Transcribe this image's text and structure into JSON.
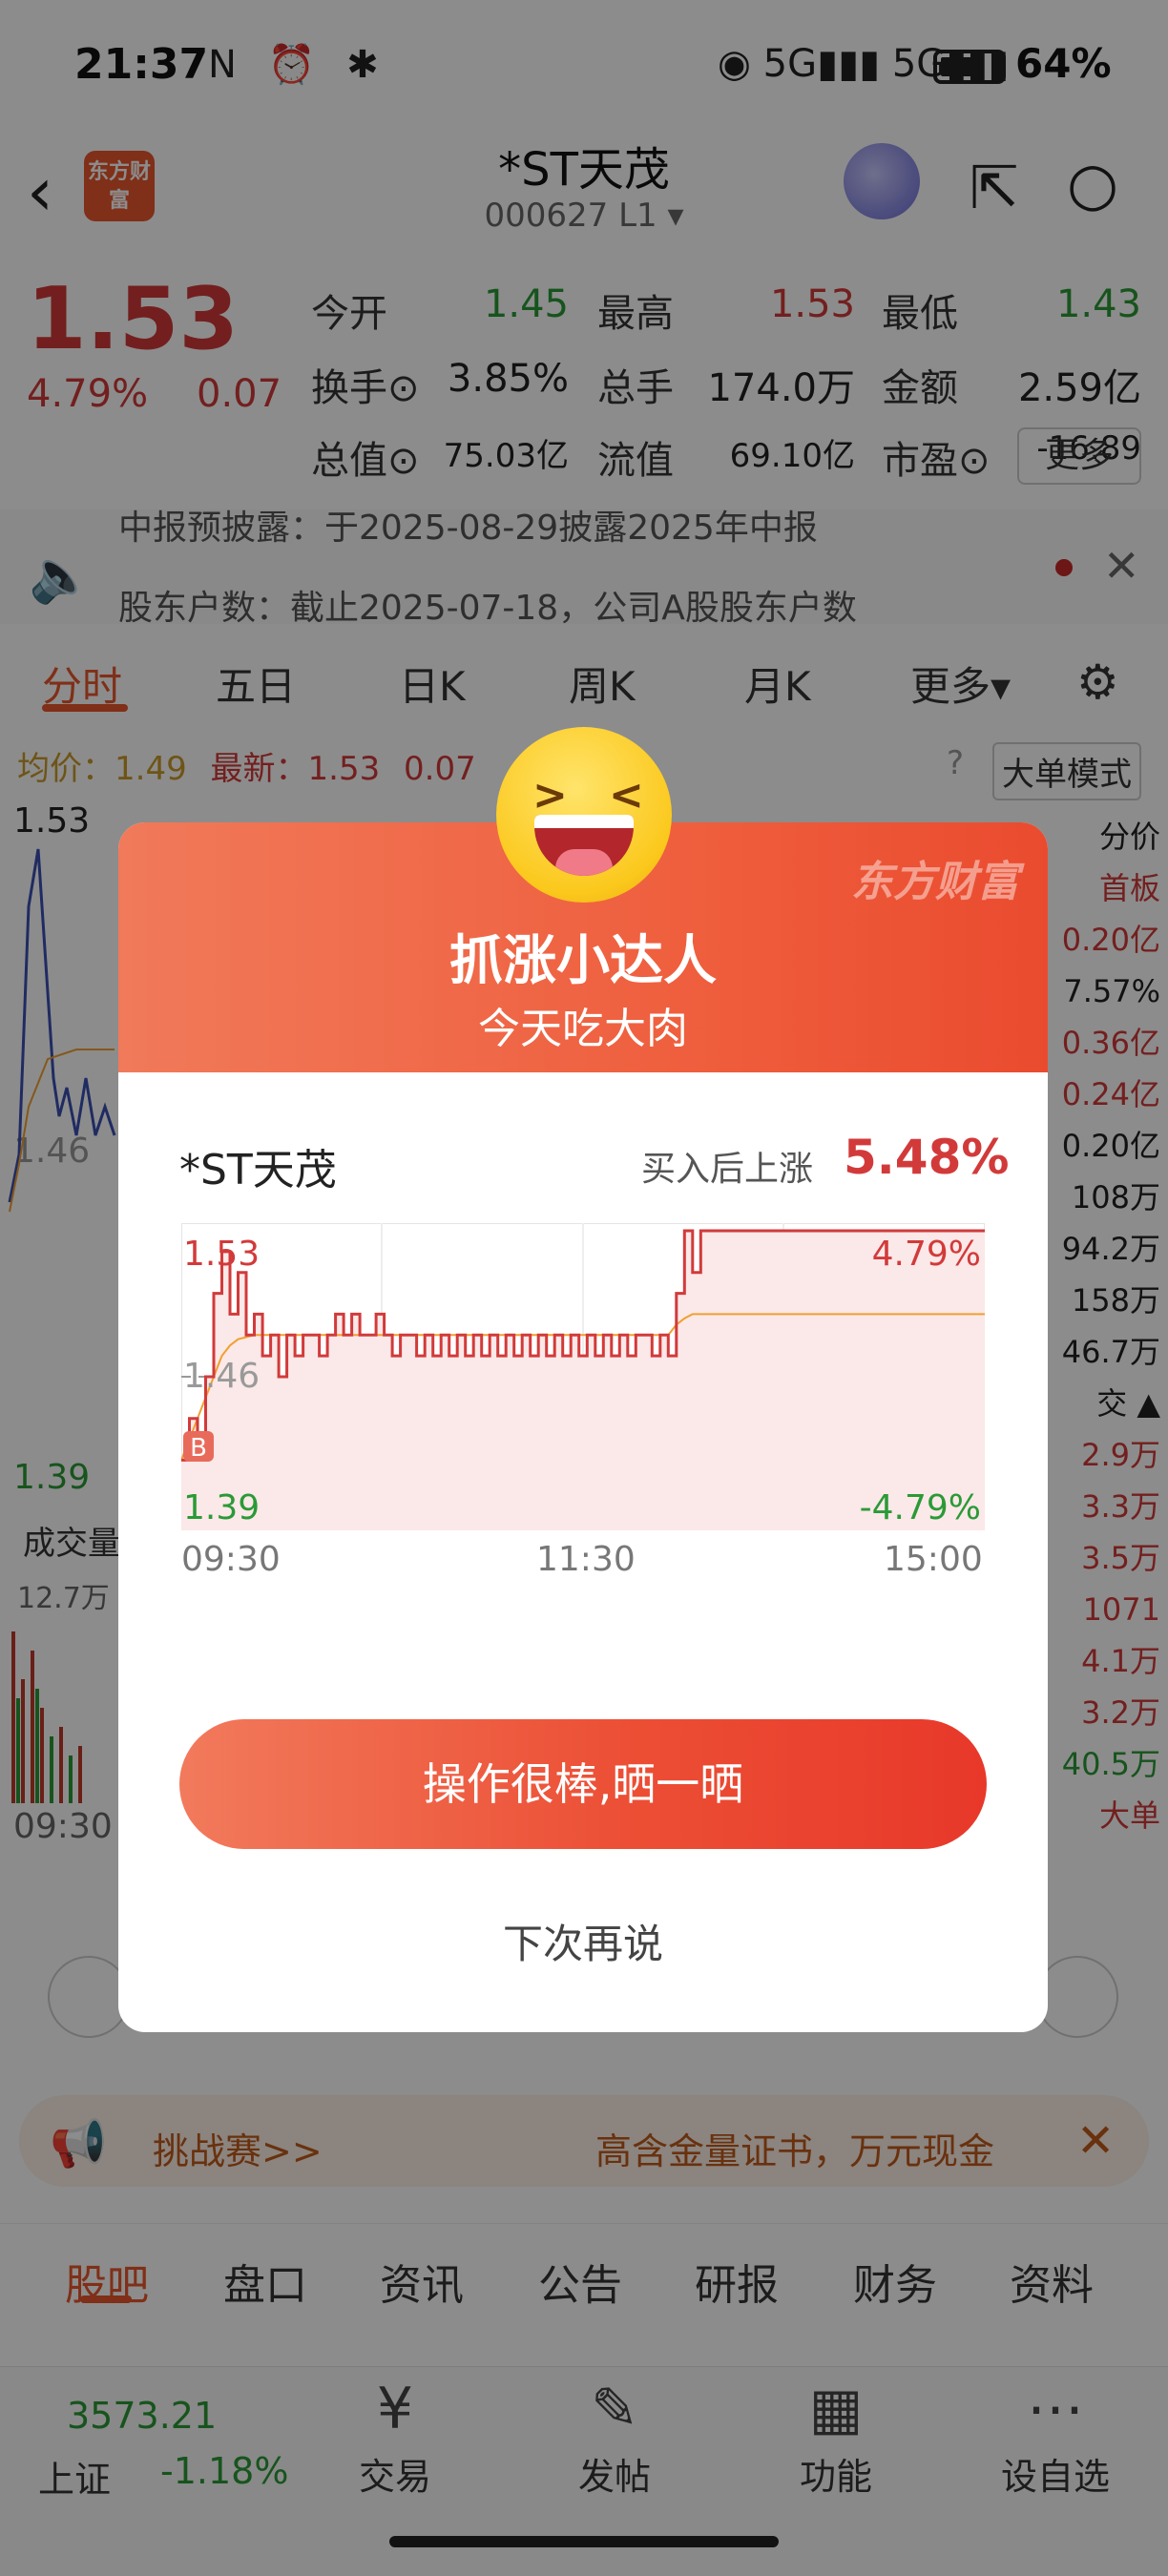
{
  "status_bar": {
    "time": "21:37",
    "left_icons": "N ⏰ ✱",
    "signal": "◉ 5G▮▮▮ 5G▮▮▮",
    "battery": "64%"
  },
  "header": {
    "title": "*ST天茂",
    "code": "000627 L1 ▾",
    "logo_text": "东方财富"
  },
  "quote": {
    "price": "1.53",
    "pct": "4.79%",
    "change": "0.07",
    "rows": [
      [
        {
          "label": "今开",
          "value": "1.45",
          "tone": "green"
        },
        {
          "label": "最高",
          "value": "1.53",
          "tone": "red"
        },
        {
          "label": "最低",
          "value": "1.43",
          "tone": "green"
        }
      ],
      [
        {
          "label": "换手⊙",
          "value": "3.85%",
          "tone": "dark"
        },
        {
          "label": "总手",
          "value": "174.0万",
          "tone": "dark"
        },
        {
          "label": "金额",
          "value": "2.59亿",
          "tone": "dark"
        }
      ],
      [
        {
          "label": "总值⊙",
          "value": "75.03亿",
          "tone": "dark"
        },
        {
          "label": "流值",
          "value": "69.10亿",
          "tone": "dark"
        },
        {
          "label": "市盈⊙",
          "value": "-16.89",
          "tone": "dark"
        }
      ]
    ],
    "more": "更多"
  },
  "notice": {
    "line1": "中报预披露：于2025-08-29披露2025年中报",
    "line2": "股东户数：截止2025-07-18，公司A股股东户数"
  },
  "chart_tabs": [
    "分时",
    "五日",
    "日K",
    "周K",
    "月K",
    "更多▾"
  ],
  "chart_info": {
    "avg_label": "均价：",
    "avg_value": "1.49",
    "latest_label": "最新：",
    "latest_value": "1.53",
    "latest_change": "0.07",
    "big_order": "大单模式",
    "price_hi": "1.53",
    "price_mid": "1.46",
    "price_lo": "1.39",
    "volume_label": "成交量",
    "volume_value": "12.7万",
    "time_start": "09:30"
  },
  "side_column": [
    {
      "text": "分价",
      "tone": "dark"
    },
    {
      "text": "首板",
      "tone": "red"
    },
    {
      "text": "0.20亿",
      "tone": "red"
    },
    {
      "text": "7.57%",
      "tone": "dark"
    },
    {
      "text": "0.36亿",
      "tone": "red"
    },
    {
      "text": "0.24亿",
      "tone": "red"
    },
    {
      "text": "0.20亿",
      "tone": "dark"
    },
    {
      "text": "108万",
      "tone": "dark"
    },
    {
      "text": "94.2万",
      "tone": "dark"
    },
    {
      "text": "158万",
      "tone": "dark"
    },
    {
      "text": "46.7万",
      "tone": "dark"
    },
    {
      "text": "交 ▲",
      "tone": "dark"
    },
    {
      "text": "2.9万",
      "tone": "red"
    },
    {
      "text": "3.3万",
      "tone": "red"
    },
    {
      "text": "3.5万",
      "tone": "red"
    },
    {
      "text": "1071",
      "tone": "red"
    },
    {
      "text": "4.1万",
      "tone": "red"
    },
    {
      "text": "3.2万",
      "tone": "red"
    },
    {
      "text": "40.5万",
      "tone": "green"
    },
    {
      "text": "大单",
      "tone": "red"
    }
  ],
  "banner": {
    "left": "挑战赛>>",
    "right": "高含金量证书，万元现金"
  },
  "bottom_tabs": [
    "股吧",
    "盘口",
    "资讯",
    "公告",
    "研报",
    "财务",
    "资料"
  ],
  "bottom_nav": {
    "index_value": "3573.21",
    "index_name": "上证",
    "index_pct": "-1.18%",
    "items": [
      {
        "icon": "¥",
        "label": "交易"
      },
      {
        "icon": "✎",
        "label": "发帖"
      },
      {
        "icon": "▦",
        "label": "功能"
      },
      {
        "icon": "⋯",
        "label": "设自选"
      }
    ]
  },
  "modal": {
    "watermark": "东方财富",
    "title": "抓涨小达人",
    "subtitle": "今天吃大肉",
    "stock": "*ST天茂",
    "rise_label": "买入后上涨",
    "rise_value": "5.48%",
    "share_button": "操作很棒,晒一晒",
    "later_button": "下次再说"
  },
  "chart_data": {
    "type": "line",
    "y_left_labels": [
      "1.53",
      "1.46",
      "1.39"
    ],
    "y_right_labels": [
      "4.79%",
      "-4.79%"
    ],
    "x_labels": [
      "09:30",
      "11:30",
      "15:00"
    ],
    "ylim": [
      1.39,
      1.53
    ],
    "buy_marker": "B",
    "series": [
      {
        "values": [
          1.42,
          1.44,
          1.43,
          1.46,
          1.5,
          1.52,
          1.49,
          1.51,
          1.48,
          1.49,
          1.47,
          1.48,
          1.46,
          1.48,
          1.47,
          1.48,
          1.48,
          1.47,
          1.48,
          1.49,
          1.48,
          1.49,
          1.48,
          1.48,
          1.49,
          1.48,
          1.47,
          1.48,
          1.48,
          1.47,
          1.48,
          1.47,
          1.48,
          1.47,
          1.48,
          1.47,
          1.48,
          1.47,
          1.48,
          1.47,
          1.48,
          1.47,
          1.48,
          1.47,
          1.48,
          1.47,
          1.48,
          1.47,
          1.48,
          1.47,
          1.48,
          1.47,
          1.48,
          1.47,
          1.48,
          1.47,
          1.48,
          1.48,
          1.47,
          1.48,
          1.47,
          1.5,
          1.53,
          1.51,
          1.53,
          1.53,
          1.53,
          1.53,
          1.53,
          1.53,
          1.53,
          1.53,
          1.53,
          1.53,
          1.53,
          1.53,
          1.53,
          1.53,
          1.53,
          1.53,
          1.53,
          1.53,
          1.53,
          1.53,
          1.53,
          1.53,
          1.53,
          1.53,
          1.53,
          1.53,
          1.53,
          1.53,
          1.53,
          1.53,
          1.53,
          1.53,
          1.53,
          1.53,
          1.53,
          1.53
        ]
      },
      {
        "values": [
          1.42,
          1.43,
          1.44,
          1.45,
          1.46,
          1.47,
          1.475,
          1.478,
          1.479,
          1.48,
          1.48,
          1.48,
          1.48,
          1.48,
          1.48,
          1.48,
          1.48,
          1.48,
          1.48,
          1.48,
          1.48,
          1.48,
          1.48,
          1.48,
          1.48,
          1.48,
          1.48,
          1.48,
          1.48,
          1.48,
          1.48,
          1.48,
          1.48,
          1.48,
          1.48,
          1.48,
          1.48,
          1.48,
          1.48,
          1.48,
          1.48,
          1.48,
          1.48,
          1.48,
          1.48,
          1.48,
          1.48,
          1.48,
          1.48,
          1.48,
          1.48,
          1.48,
          1.48,
          1.48,
          1.48,
          1.48,
          1.48,
          1.48,
          1.48,
          1.48,
          1.48,
          1.485,
          1.488,
          1.49,
          1.49,
          1.49,
          1.49,
          1.49,
          1.49,
          1.49,
          1.49,
          1.49,
          1.49,
          1.49,
          1.49,
          1.49,
          1.49,
          1.49,
          1.49,
          1.49,
          1.49,
          1.49,
          1.49,
          1.49,
          1.49,
          1.49,
          1.49,
          1.49,
          1.49,
          1.49,
          1.49,
          1.49,
          1.49,
          1.49,
          1.49,
          1.49,
          1.49,
          1.49,
          1.49,
          1.49
        ]
      }
    ],
    "colors": {
      "price": "#d23a3a",
      "avg": "#f0a030",
      "fill": "#fbe8e8"
    }
  }
}
